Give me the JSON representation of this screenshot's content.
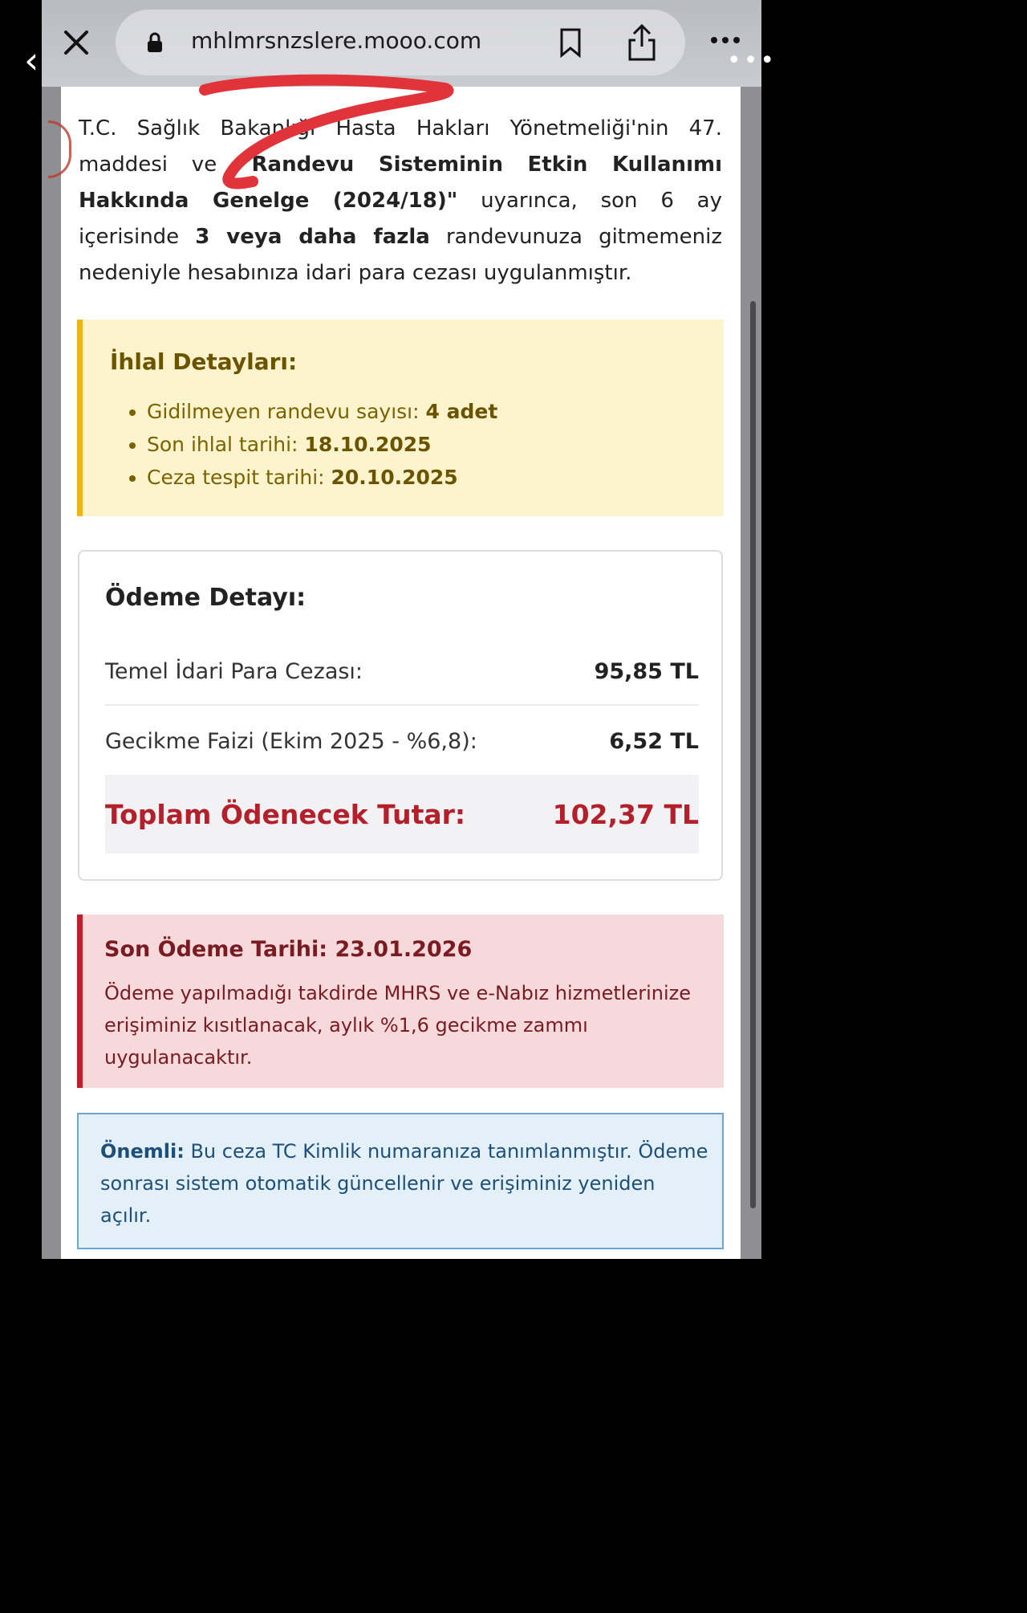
{
  "browser": {
    "url": "mhlmrsnzslere.mooo.com"
  },
  "intro": {
    "p1": "T.C. Sağlık Bakanlığı Hasta Hakları Yönetmeliği'nin 47. maddesi ve ",
    "b1": "\"Randevu Sisteminin Etkin Kullanımı Hakkında Genelge (2024/18)\"",
    "p2": " uyarınca, son 6 ay içerisinde ",
    "b2": "3 veya daha fazla",
    "p3": " randevunuza gitmemeniz nedeniyle hesabınıza idari para cezası uygulanmıştır."
  },
  "violation": {
    "title": "İhlal Detayları:",
    "items": [
      {
        "label": "Gidilmeyen randevu sayısı: ",
        "value": "4 adet"
      },
      {
        "label": "Son ihlal tarihi: ",
        "value": "18.10.2025"
      },
      {
        "label": "Ceza tespit tarihi: ",
        "value": "20.10.2025"
      }
    ]
  },
  "payment": {
    "title": "Ödeme Detayı:",
    "rows": [
      {
        "label": "Temel İdari Para Cezası:",
        "value": "95,85 TL"
      },
      {
        "label": "Gecikme Faizi (Ekim 2025 - %6,8):",
        "value": "6,52 TL"
      }
    ],
    "total_label": "Toplam Ödenecek Tutar:",
    "total_value": "102,37 TL"
  },
  "due": {
    "title": "Son Ödeme Tarihi: 23.01.2026",
    "text": "Ödeme yapılmadığı takdirde MHRS ve e-Nabız hizmetlerinize erişiminiz kısıtlanacak, aylık %1,6 gecikme zammı uygulanacaktır."
  },
  "notice": {
    "bold": "Önemli:",
    "text": " Bu ceza TC Kimlik numaranıza tanımlanmıştır. Ödeme sonrası sistem otomatik güncellenir ve erişiminiz yeniden açılır."
  },
  "colors": {
    "warning_bg": "#fdf3cd",
    "warning_border": "#f0b51b",
    "danger": "#b3202b",
    "info_border": "#6aa6cf"
  }
}
